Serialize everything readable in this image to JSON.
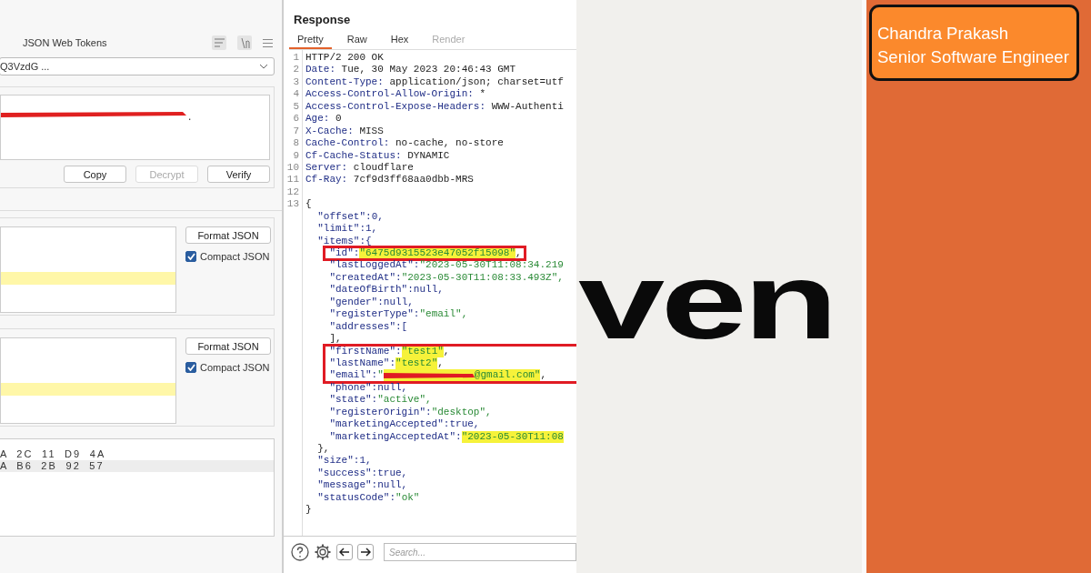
{
  "inspector": {
    "title": "JSON Web Tokens",
    "token_select": {
      "value": "Q3VzdG ..."
    },
    "token_field": {
      "trailing_text": "."
    },
    "buttons": [
      {
        "label": "Copy",
        "disabled": false
      },
      {
        "label": "Decrypt",
        "disabled": true
      },
      {
        "label": "Verify",
        "disabled": false
      }
    ],
    "sections": [
      {
        "format_button": "Format JSON",
        "compact": {
          "label": "Compact JSON",
          "checked": true
        }
      },
      {
        "format_button": "Format JSON",
        "compact": {
          "label": "Compact JSON",
          "checked": true
        }
      }
    ],
    "hex_rows": [
      {
        "text": "A 2C 11 D9 4A",
        "selected": false
      },
      {
        "text": "A B6 2B 92 57",
        "selected": true
      }
    ]
  },
  "response": {
    "title": "Response",
    "tabs": [
      {
        "label": "Pretty",
        "selected": true,
        "disabled": false
      },
      {
        "label": "Raw",
        "selected": false,
        "disabled": false
      },
      {
        "label": "Hex",
        "selected": false,
        "disabled": false
      },
      {
        "label": "Render",
        "selected": false,
        "disabled": true
      }
    ],
    "lines": [
      {
        "number": "1",
        "parts": [
          {
            "text": "HTTP/2 200 OK",
            "kind": "plain"
          }
        ]
      },
      {
        "number": "2",
        "parts": [
          {
            "text": "Date:",
            "kind": "key"
          },
          {
            "text": " Tue, 30 May 2023 20:46:43 GMT",
            "kind": "plain"
          }
        ]
      },
      {
        "number": "3",
        "parts": [
          {
            "text": "Content-Type:",
            "kind": "key"
          },
          {
            "text": " application/json; charset=utf",
            "kind": "plain"
          }
        ]
      },
      {
        "number": "4",
        "parts": [
          {
            "text": "Access-Control-Allow-Origin:",
            "kind": "key"
          },
          {
            "text": " *",
            "kind": "plain"
          }
        ]
      },
      {
        "number": "5",
        "parts": [
          {
            "text": "Access-Control-Expose-Headers:",
            "kind": "key"
          },
          {
            "text": " WWW-Authenti",
            "kind": "plain"
          }
        ]
      },
      {
        "number": "6",
        "parts": [
          {
            "text": "Age:",
            "kind": "key"
          },
          {
            "text": " 0",
            "kind": "plain"
          }
        ]
      },
      {
        "number": "7",
        "parts": [
          {
            "text": "X-Cache:",
            "kind": "key"
          },
          {
            "text": " MISS",
            "kind": "plain"
          }
        ]
      },
      {
        "number": "8",
        "parts": [
          {
            "text": "Cache-Control:",
            "kind": "key"
          },
          {
            "text": " no-cache, no-store",
            "kind": "plain"
          }
        ]
      },
      {
        "number": "9",
        "parts": [
          {
            "text": "Cf-Cache-Status:",
            "kind": "key"
          },
          {
            "text": " DYNAMIC",
            "kind": "plain"
          }
        ]
      },
      {
        "number": "10",
        "parts": [
          {
            "text": "Server:",
            "kind": "key"
          },
          {
            "text": " cloudflare",
            "kind": "plain"
          }
        ]
      },
      {
        "number": "11",
        "parts": [
          {
            "text": "Cf-Ray:",
            "kind": "key"
          },
          {
            "text": " 7cf9d3ff68aa0dbb-MRS",
            "kind": "plain"
          }
        ]
      },
      {
        "number": "12"
      },
      {
        "number": "13",
        "parts": [
          {
            "text": "{",
            "kind": "plain"
          }
        ]
      },
      {
        "parts": [
          {
            "text": "  \"offset\":",
            "kind": "key"
          },
          {
            "text": "0,",
            "kind": "literal"
          }
        ]
      },
      {
        "parts": [
          {
            "text": "  \"limit\":",
            "kind": "key"
          },
          {
            "text": "1,",
            "kind": "literal"
          }
        ]
      },
      {
        "parts": [
          {
            "text": "  \"items\":{",
            "kind": "key"
          }
        ]
      },
      {
        "kind": "outlined",
        "lines": [
          {
            "parts": [
              {
                "text": "    \"id\":",
                "kind": "key"
              },
              {
                "text": "\"6475d9315523e47052f15098\"",
                "kind": "marked"
              },
              {
                "text": ",",
                "kind": "plain"
              }
            ]
          }
        ]
      },
      {
        "parts": [
          {
            "text": "    \"lastLoggedAt\":",
            "kind": "key"
          },
          {
            "text": "\"2023-05-30T11:08:34.219",
            "kind": "string"
          }
        ]
      },
      {
        "parts": [
          {
            "text": "    \"createdAt\":",
            "kind": "key"
          },
          {
            "text": "\"2023-05-30T11:08:33.493Z\",",
            "kind": "string"
          }
        ]
      },
      {
        "parts": [
          {
            "text": "    \"dateOfBirth\":",
            "kind": "key"
          },
          {
            "text": "null,",
            "kind": "literal"
          }
        ]
      },
      {
        "parts": [
          {
            "text": "    \"gender\":",
            "kind": "key"
          },
          {
            "text": "null,",
            "kind": "literal"
          }
        ]
      },
      {
        "parts": [
          {
            "text": "    \"registerType\":",
            "kind": "key"
          },
          {
            "text": "\"email\",",
            "kind": "string"
          }
        ]
      },
      {
        "parts": [
          {
            "text": "    \"addresses\":[",
            "kind": "key"
          }
        ]
      },
      {
        "parts": [
          {
            "text": "    ],",
            "kind": "plain"
          }
        ]
      },
      {
        "kind": "outlined",
        "lines": [
          {
            "parts": [
              {
                "text": "    \"firstName\":",
                "kind": "key"
              },
              {
                "text": "\"test1\"",
                "kind": "marked"
              },
              {
                "text": ",",
                "kind": "plain"
              }
            ]
          },
          {
            "parts": [
              {
                "text": "    \"lastName\":",
                "kind": "key"
              },
              {
                "text": "\"test2\"",
                "kind": "marked"
              },
              {
                "text": ",",
                "kind": "plain"
              }
            ]
          },
          {
            "parts": [
              {
                "text": "    \"email\":",
                "kind": "key"
              },
              {
                "text": "\"",
                "kind": "string"
              },
              {
                "kind": "redaction"
              },
              {
                "text": "@gmail.com\"",
                "kind": "marked"
              },
              {
                "text": ",",
                "kind": "plain"
              }
            ]
          }
        ]
      },
      {
        "parts": [
          {
            "text": "    \"phone\":",
            "kind": "key"
          },
          {
            "text": "null,",
            "kind": "literal"
          }
        ]
      },
      {
        "parts": [
          {
            "text": "    \"state\":",
            "kind": "key"
          },
          {
            "text": "\"active\",",
            "kind": "string"
          }
        ]
      },
      {
        "parts": [
          {
            "text": "    \"registerOrigin\":",
            "kind": "key"
          },
          {
            "text": "\"desktop\",",
            "kind": "string"
          }
        ]
      },
      {
        "parts": [
          {
            "text": "    \"marketingAccepted\":",
            "kind": "key"
          },
          {
            "text": "true,",
            "kind": "literal"
          }
        ]
      },
      {
        "parts": [
          {
            "text": "    \"marketingAcceptedAt\":",
            "kind": "key"
          },
          {
            "text": "\"2023-05-30T11:08",
            "kind": "marked"
          }
        ]
      },
      {
        "parts": [
          {
            "text": "  },",
            "kind": "plain"
          }
        ]
      },
      {
        "parts": [
          {
            "text": "  \"size\":",
            "kind": "key"
          },
          {
            "text": "1,",
            "kind": "literal"
          }
        ]
      },
      {
        "parts": [
          {
            "text": "  \"success\":",
            "kind": "key"
          },
          {
            "text": "true,",
            "kind": "literal"
          }
        ]
      },
      {
        "parts": [
          {
            "text": "  \"message\":",
            "kind": "key"
          },
          {
            "text": "null,",
            "kind": "literal"
          }
        ]
      },
      {
        "parts": [
          {
            "text": "  \"statusCode\":",
            "kind": "key"
          },
          {
            "text": "\"ok\"",
            "kind": "string"
          }
        ]
      },
      {
        "parts": [
          {
            "text": "}",
            "kind": "plain"
          }
        ]
      }
    ],
    "search": {
      "placeholder": "Search..."
    }
  },
  "slide": {
    "word": "ven",
    "card": {
      "name": "Chandra Prakash",
      "role": "Senior Software Engineer"
    }
  }
}
